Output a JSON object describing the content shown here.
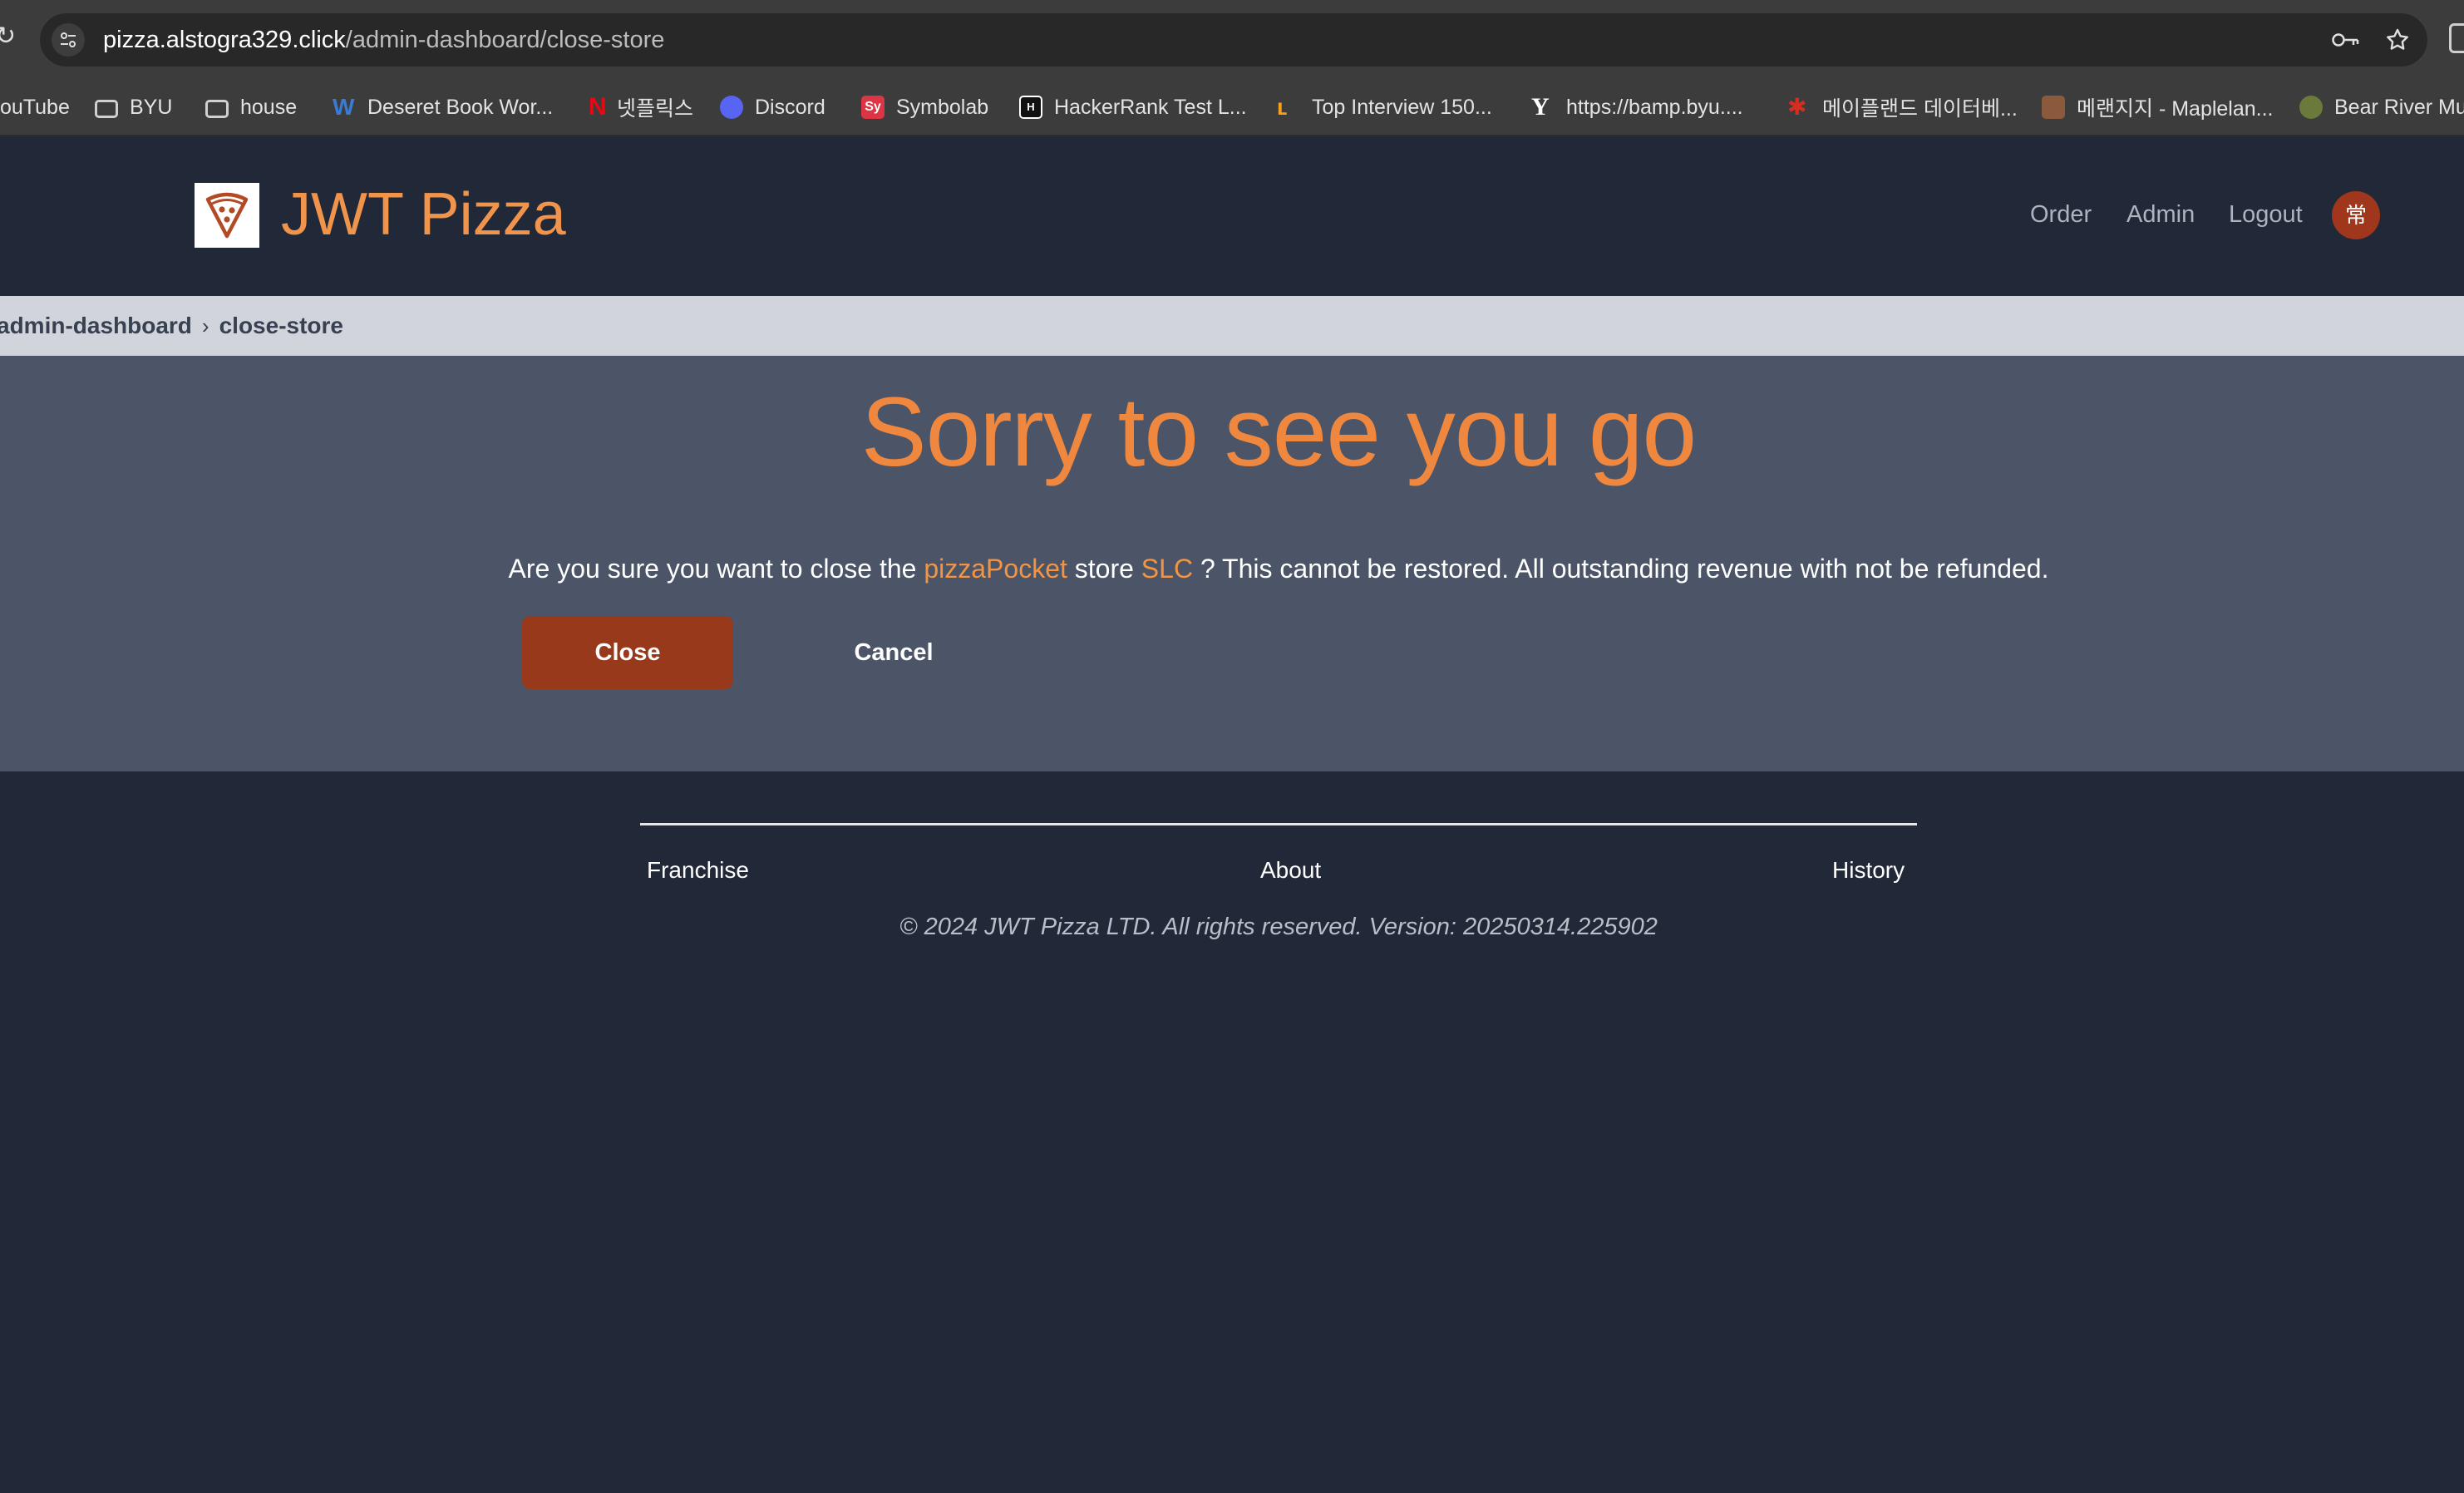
{
  "browser": {
    "url_host": "pizza.alstogra329.click",
    "url_path": "/admin-dashboard/close-store",
    "bookmarks": [
      {
        "label": "ouTube",
        "icon": "youtube-icon"
      },
      {
        "label": "BYU",
        "icon": "folder-icon"
      },
      {
        "label": "house",
        "icon": "folder-icon"
      },
      {
        "label": "Deseret Book Wor...",
        "icon": "deseret-book-icon"
      },
      {
        "label": "넷플릭스",
        "icon": "netflix-icon"
      },
      {
        "label": "Discord",
        "icon": "discord-icon"
      },
      {
        "label": "Symbolab",
        "icon": "symbolab-icon"
      },
      {
        "label": "HackerRank Test L...",
        "icon": "hackerrank-icon"
      },
      {
        "label": "Top Interview 150...",
        "icon": "leetcode-icon"
      },
      {
        "label": "https://bamp.byu....",
        "icon": "byu-icon"
      },
      {
        "label": "메이플랜드 데이터베...",
        "icon": "maple-leaf-icon"
      },
      {
        "label": "메랜지지 - Maplelan...",
        "icon": "maplelan-icon"
      },
      {
        "label": "Bear River Mu",
        "icon": "bear-river-icon"
      }
    ]
  },
  "header": {
    "brand": "JWT Pizza",
    "nav": [
      "Order",
      "Admin",
      "Logout"
    ],
    "avatar": "常"
  },
  "breadcrumb": {
    "items": [
      "admin-dashboard",
      "close-store"
    ],
    "separator": "›"
  },
  "main": {
    "title": "Sorry to see you go",
    "text_before_franchise": "Are you sure you want to close the ",
    "franchise": "pizzaPocket",
    "text_store": " store ",
    "store": "SLC",
    "text_after": " ? This cannot be restored. All outstanding revenue with not be refunded.",
    "close_label": "Close",
    "cancel_label": "Cancel"
  },
  "footer": {
    "links": [
      "Franchise",
      "About",
      "History"
    ],
    "copyright": "© 2024 JWT Pizza LTD. All rights reserved. Version: 20250314.225902"
  },
  "colors": {
    "accent": "#f0873f",
    "close_button": "#98391b",
    "background": "#212837",
    "main_panel": "#4b5567",
    "breadcrumb_bar": "#d1d5db"
  }
}
